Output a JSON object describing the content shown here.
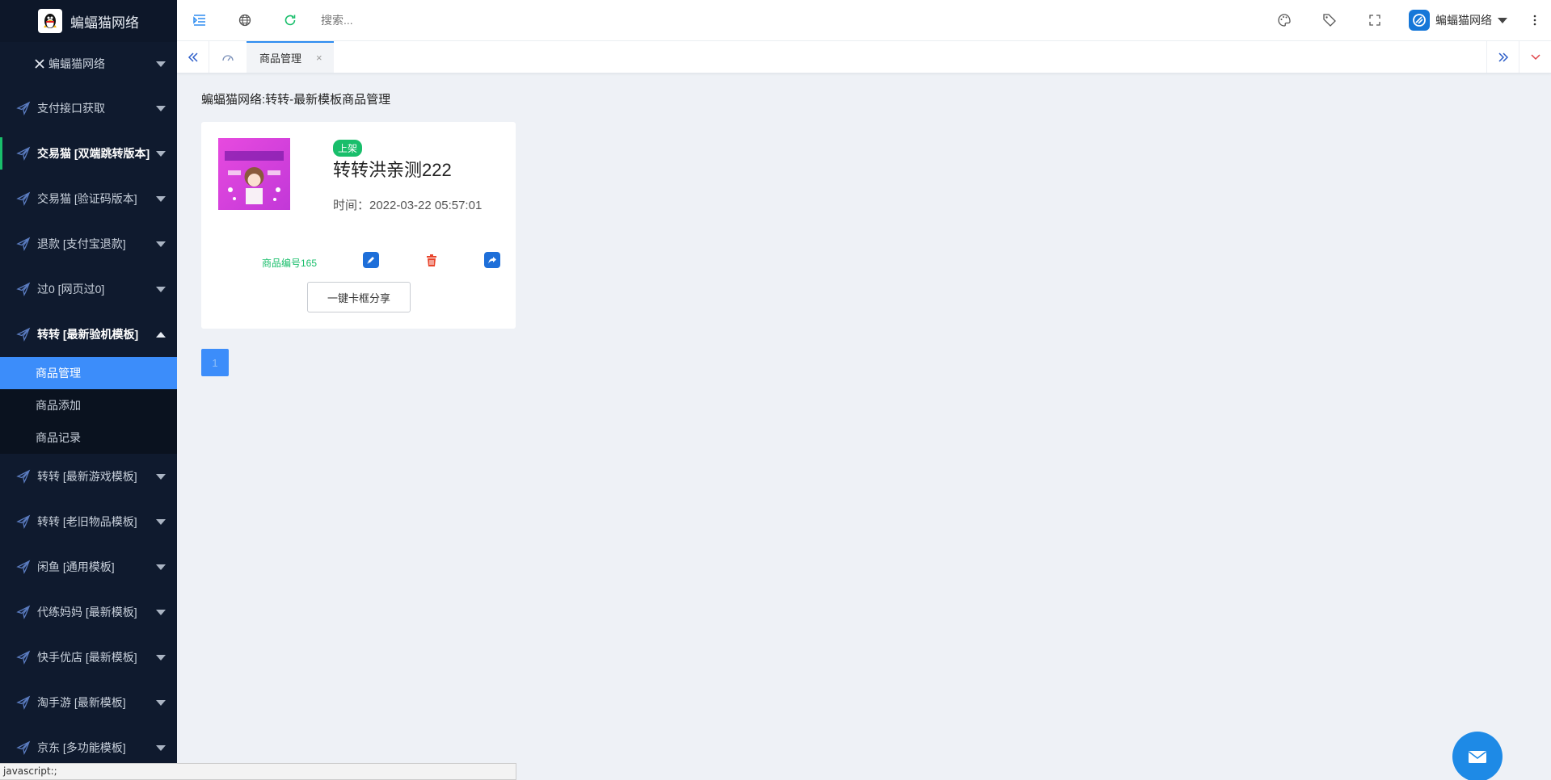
{
  "sidebar": {
    "logo_title": "蝙蝠猫网络",
    "top_item": "蝙蝠猫网络",
    "items": [
      {
        "label": "支付接口获取"
      },
      {
        "label": "交易猫 [双端跳转版本]"
      },
      {
        "label": "交易猫 [验证码版本]"
      },
      {
        "label": "退款 [支付宝退款]"
      },
      {
        "label": "过0 [网页过0]"
      },
      {
        "label": "转转 [最新验机模板]"
      },
      {
        "label": "转转 [最新游戏模板]"
      },
      {
        "label": "转转 [老旧物品模板]"
      },
      {
        "label": "闲鱼 [通用模板]"
      },
      {
        "label": "代练妈妈 [最新模板]"
      },
      {
        "label": "快手优店 [最新模板]"
      },
      {
        "label": "淘手游 [最新模板]"
      },
      {
        "label": "京东 [多功能模板]"
      }
    ],
    "submenu": [
      {
        "label": "商品管理",
        "active": true
      },
      {
        "label": "商品添加"
      },
      {
        "label": "商品记录"
      }
    ]
  },
  "header": {
    "search_placeholder": "搜索...",
    "user_name": "蝙蝠猫网络"
  },
  "tabs": [
    {
      "label": "商品管理",
      "close": "×"
    }
  ],
  "main": {
    "title": "蝙蝠猫网络:转转-最新模板商品管理",
    "product": {
      "status_badge": "上架",
      "title": "转转洪亲测222",
      "time": "时间：2022-03-22 05:57:01",
      "id_label": "商品编号165",
      "share_button": "一键卡框分享"
    },
    "pagination": {
      "current": "1"
    }
  },
  "statusbar": {
    "text": "javascript:;"
  },
  "colors": {
    "sidebar_bg": "#0f1a2e",
    "accent": "#3c8dfa",
    "green": "#19be6b",
    "delete": "#e8452c"
  }
}
